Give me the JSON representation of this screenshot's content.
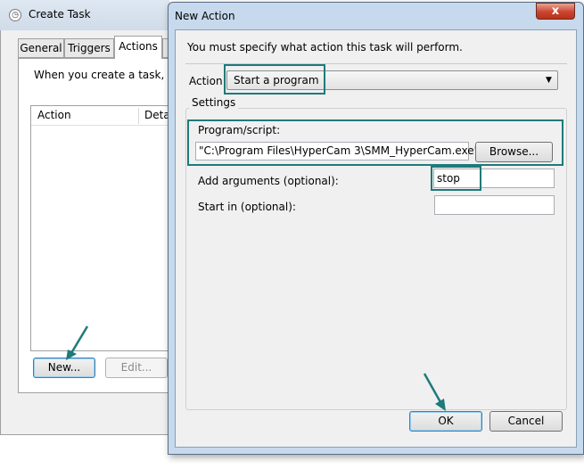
{
  "create_task": {
    "title": "Create Task",
    "tabs": [
      {
        "label": "General"
      },
      {
        "label": "Triggers"
      },
      {
        "label": "Actions"
      }
    ],
    "description": "When you create a task, you",
    "columns": [
      "Action",
      "Deta"
    ],
    "new_button": "New...",
    "edit_button": "Edit..."
  },
  "new_action": {
    "title": "New Action",
    "close_glyph": "x",
    "instruction": "You must specify what action this task will perform.",
    "action_label": "Action:",
    "action_value": "Start a program",
    "settings_label": "Settings",
    "program_label": "Program/script:",
    "program_value": "\"C:\\Program Files\\HyperCam 3\\SMM_HyperCam.exe\"",
    "browse_button": "Browse...",
    "arguments_label": "Add arguments (optional):",
    "arguments_value": "stop",
    "start_in_label": "Start in (optional):",
    "start_in_value": "",
    "ok_button": "OK",
    "cancel_button": "Cancel"
  },
  "colors": {
    "highlight": "#1f7a7a",
    "title_bar": "#c7d9ec",
    "close_button": "#c9452f"
  }
}
